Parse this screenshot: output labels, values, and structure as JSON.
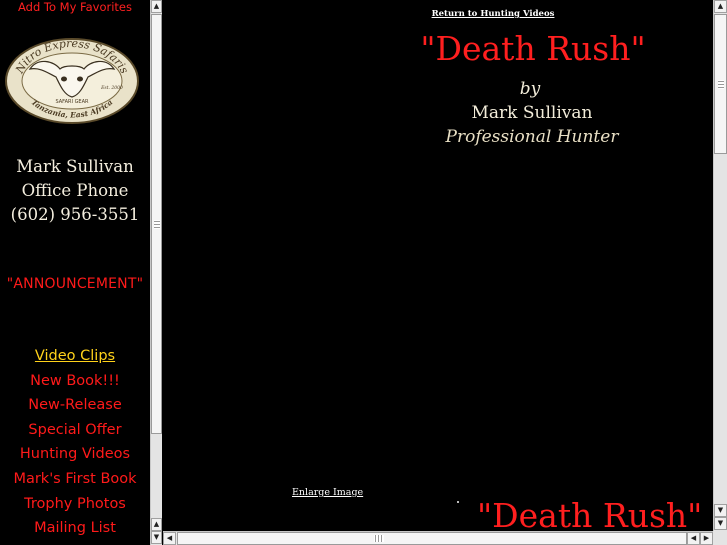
{
  "sidebar": {
    "favorites_link": "Add To My Favorites",
    "logo": {
      "name_text": "Nitro Express Safaris",
      "est_text": "Est. 2000",
      "gear_text": "SAFARI GEAR",
      "location_text": "Tanzania, East Africa"
    },
    "contact": {
      "name": "Mark Sullivan",
      "phone_label": "Office Phone",
      "phone": "(602) 956-3551"
    },
    "announcement": "\"ANNOUNCEMENT\"",
    "nav": [
      {
        "label": "Video Clips"
      },
      {
        "label": "New Book!!!"
      },
      {
        "label": "New-Release"
      },
      {
        "label": "Special Offer"
      },
      {
        "label": "Hunting Videos"
      },
      {
        "label": "Mark's First Book"
      },
      {
        "label": "Trophy Photos"
      },
      {
        "label": "Mailing List"
      }
    ]
  },
  "main": {
    "return_link": "Return to Hunting Videos",
    "title": "\"Death Rush\"",
    "by": "by",
    "author": "Mark Sullivan",
    "profession": "Professional Hunter",
    "enlarge_link": "Enlarge Image",
    "bottom_title": "\"Death Rush\""
  },
  "colors": {
    "background": "#000000",
    "accent_red": "#ff1f1f",
    "nav_active": "#ffd21a",
    "text_cream": "#f3edda"
  },
  "icons": {
    "scroll_up": "arrow-up-icon",
    "scroll_down": "arrow-down-icon",
    "scroll_left": "arrow-left-icon",
    "scroll_right": "arrow-right-icon"
  }
}
